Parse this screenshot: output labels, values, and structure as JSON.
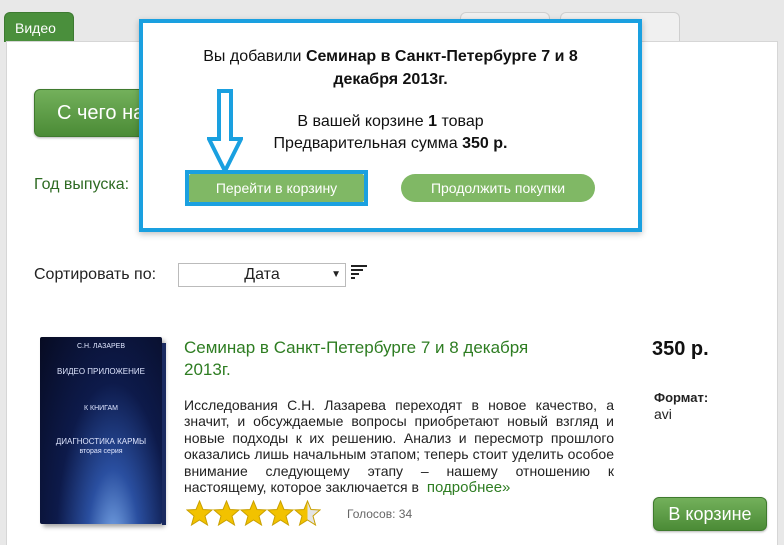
{
  "tabs": {
    "active": "Видео"
  },
  "buttons": {
    "start": "С чего на"
  },
  "filters": {
    "year_label": "Год выпуска:"
  },
  "sort": {
    "label": "Сортировать по:",
    "selected": "Дата"
  },
  "product": {
    "cover": {
      "author": "С.Н. ЛАЗАРЕВ",
      "title": "ВИДЕО ПРИЛОЖЕНИЕ",
      "books": "К КНИГАМ",
      "series_name": "ДИАГНОСТИКА КАРМЫ",
      "series_sub": "вторая серия"
    },
    "title": "Семинар в Санкт-Петербурге 7 и 8 декабря 2013г.",
    "description": "Исследования С.Н. Лазарева переходят в новое качество, а значит, и обсуждаемые вопросы приобретают новый взгляд и новые подходы к их решению. Анализ и пересмотр прошлого оказались лишь начальным этапом; теперь стоит уделить особое внимание следующему этапу – нашему отношению к настоящему, которое заключается в",
    "more_link": "подробнее»",
    "price": "350 р.",
    "format_label": "Формат:",
    "format_value": "avi",
    "rating": 4.5,
    "votes": "Голосов: 34",
    "cart_button": "В корзине"
  },
  "popup": {
    "added_prefix": "Вы добавили ",
    "added_item": "Семинар в Санкт-Петербурге 7 и 8 декабря 2013г.",
    "cart_prefix": "В вашей корзине ",
    "cart_count": "1",
    "cart_suffix": " товар",
    "sum_prefix": "Предварительная сумма ",
    "sum_value": "350 р.",
    "go_cart": "Перейти в корзину",
    "continue": "Продолжить покупки"
  },
  "colors": {
    "accent_green": "#4b8b36",
    "link_green": "#2e7d22",
    "highlight_blue": "#1aa0e0"
  }
}
